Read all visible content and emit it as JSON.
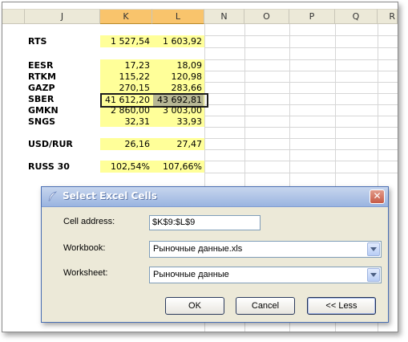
{
  "spreadsheet": {
    "columns": [
      "J",
      "K",
      "L",
      "N",
      "O",
      "P",
      "Q",
      "R"
    ],
    "rows": [
      {
        "label": "RTS",
        "k": "1 527,54",
        "l": "1 603,92"
      },
      {
        "label": "EESR",
        "k": "17,23",
        "l": "18,09"
      },
      {
        "label": "RTKM",
        "k": "115,22",
        "l": "120,98"
      },
      {
        "label": "GAZP",
        "k": "270,15",
        "l": "283,66"
      },
      {
        "label": "SBER",
        "k": "41 612,20",
        "l": "43 692,81"
      },
      {
        "label": "GMKN",
        "k": "2 860,00",
        "l": "3 003,00"
      },
      {
        "label": "SNGS",
        "k": "32,31",
        "l": "33,93"
      },
      {
        "label": "USD/RUR",
        "k": "26,16",
        "l": "27,47"
      },
      {
        "label": "RUSS 30",
        "k": "102,54%",
        "l": "107,66%"
      }
    ],
    "colors": {
      "highlight": "#ffff99",
      "header_selected": "#f9c46c",
      "header": "#ece9d8"
    }
  },
  "dialog": {
    "title": "Select Excel Cells",
    "close_label": "✕",
    "cell_address_label": "Cell address:",
    "cell_address_value": "$K$9:$L$9",
    "workbook_label": "Workbook:",
    "workbook_value": "Рыночные данные.xls",
    "worksheet_label": "Worksheet:",
    "worksheet_value": "Рыночные данные",
    "ok_label": "OK",
    "cancel_label": "Cancel",
    "less_label": "<< Less"
  }
}
